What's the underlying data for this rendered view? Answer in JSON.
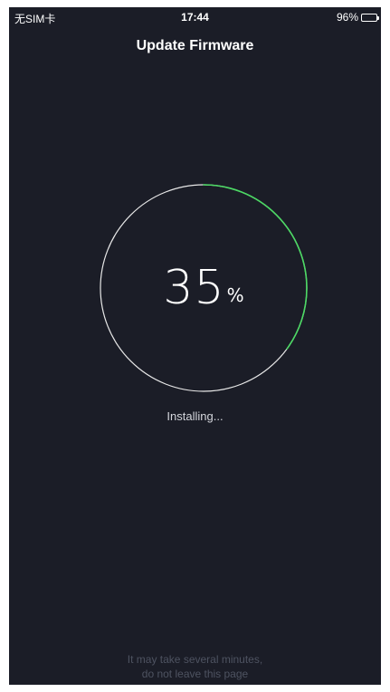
{
  "status_bar": {
    "carrier": "无SIM卡",
    "time": "17:44",
    "battery_percent": "96%",
    "battery_level": 0.96
  },
  "header": {
    "title": "Update Firmware"
  },
  "progress": {
    "value": 35,
    "number": "35",
    "unit": "%",
    "status": "Installing...",
    "ring_track_color": "#e8e8e8",
    "ring_progress_color": "#4cd964"
  },
  "footer": {
    "line1": "It may take several minutes,",
    "line2": "do not leave this page"
  },
  "colors": {
    "background": "#1b1d27",
    "text_primary": "#ffffff",
    "text_muted": "#4e5361"
  }
}
